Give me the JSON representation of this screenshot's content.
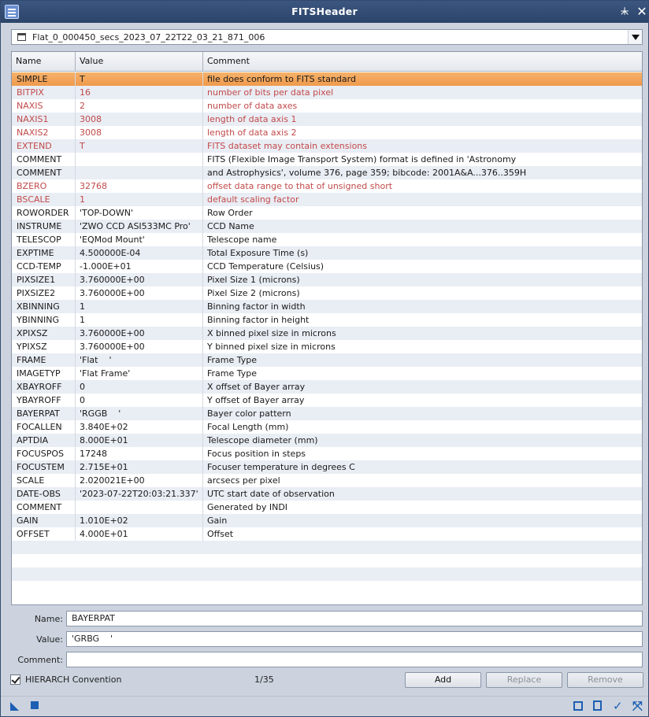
{
  "window": {
    "title": "FITSHeader",
    "app_icon": "fitsheader-app-icon",
    "collapse_icon": "⯸",
    "close_icon": "✕"
  },
  "file_select": {
    "value": "Flat_0_000450_secs_2023_07_22T22_03_21_871_006"
  },
  "table": {
    "headers": {
      "name": "Name",
      "value": "Value",
      "comment": "Comment"
    },
    "rows": [
      {
        "name": "SIMPLE",
        "value": "T",
        "comment": "file does conform to FITS standard",
        "reserved": true,
        "selected": true
      },
      {
        "name": "BITPIX",
        "value": "16",
        "comment": "number of bits per data pixel",
        "reserved": true
      },
      {
        "name": "NAXIS",
        "value": "2",
        "comment": "number of data axes",
        "reserved": true
      },
      {
        "name": "NAXIS1",
        "value": "3008",
        "comment": "length of data axis 1",
        "reserved": true
      },
      {
        "name": "NAXIS2",
        "value": "3008",
        "comment": "length of data axis 2",
        "reserved": true
      },
      {
        "name": "EXTEND",
        "value": "T",
        "comment": "FITS dataset may contain extensions",
        "reserved": true
      },
      {
        "name": "COMMENT",
        "value": "",
        "comment": "FITS (Flexible Image Transport System) format is defined in 'Astronomy"
      },
      {
        "name": "COMMENT",
        "value": "",
        "comment": "and Astrophysics', volume 376, page 359; bibcode: 2001A&A...376..359H"
      },
      {
        "name": "BZERO",
        "value": "32768",
        "comment": "offset data range to that of unsigned short",
        "reserved": true
      },
      {
        "name": "BSCALE",
        "value": "1",
        "comment": "default scaling factor",
        "reserved": true
      },
      {
        "name": "ROWORDER",
        "value": "'TOP-DOWN'",
        "comment": "Row Order"
      },
      {
        "name": "INSTRUME",
        "value": "'ZWO CCD ASI533MC Pro'",
        "comment": "CCD Name"
      },
      {
        "name": "TELESCOP",
        "value": "'EQMod Mount'",
        "comment": "Telescope name"
      },
      {
        "name": "EXPTIME",
        "value": "4.500000E-04",
        "comment": "Total Exposure Time (s)"
      },
      {
        "name": "CCD-TEMP",
        "value": "-1.000E+01",
        "comment": "CCD Temperature (Celsius)"
      },
      {
        "name": "PIXSIZE1",
        "value": "3.760000E+00",
        "comment": "Pixel Size 1 (microns)"
      },
      {
        "name": "PIXSIZE2",
        "value": "3.760000E+00",
        "comment": "Pixel Size 2 (microns)"
      },
      {
        "name": "XBINNING",
        "value": "1",
        "comment": "Binning factor in width"
      },
      {
        "name": "YBINNING",
        "value": "1",
        "comment": "Binning factor in height"
      },
      {
        "name": "XPIXSZ",
        "value": "3.760000E+00",
        "comment": "X binned pixel size in microns"
      },
      {
        "name": "YPIXSZ",
        "value": "3.760000E+00",
        "comment": "Y binned pixel size in microns"
      },
      {
        "name": "FRAME",
        "value": "'Flat    '",
        "comment": "Frame Type"
      },
      {
        "name": "IMAGETYP",
        "value": "'Flat Frame'",
        "comment": "Frame Type"
      },
      {
        "name": "XBAYROFF",
        "value": "0",
        "comment": "X offset of Bayer array"
      },
      {
        "name": "YBAYROFF",
        "value": "0",
        "comment": "Y offset of Bayer array"
      },
      {
        "name": "BAYERPAT",
        "value": "'RGGB    '",
        "comment": "Bayer color pattern"
      },
      {
        "name": "FOCALLEN",
        "value": "3.840E+02",
        "comment": "Focal Length (mm)"
      },
      {
        "name": "APTDIA",
        "value": "8.000E+01",
        "comment": "Telescope diameter (mm)"
      },
      {
        "name": "FOCUSPOS",
        "value": "17248",
        "comment": "Focus position in steps"
      },
      {
        "name": "FOCUSTEM",
        "value": "2.715E+01",
        "comment": "Focuser temperature in degrees C"
      },
      {
        "name": "SCALE",
        "value": "2.020021E+00",
        "comment": "arcsecs per pixel"
      },
      {
        "name": "DATE-OBS",
        "value": "'2023-07-22T20:03:21.337'",
        "comment": "UTC start date of observation"
      },
      {
        "name": "COMMENT",
        "value": "",
        "comment": "Generated by INDI"
      },
      {
        "name": "GAIN",
        "value": "1.010E+02",
        "comment": "Gain"
      },
      {
        "name": "OFFSET",
        "value": "4.000E+01",
        "comment": "Offset"
      }
    ]
  },
  "form": {
    "name_label": "Name:",
    "name_value": "BAYERPAT",
    "value_label": "Value:",
    "value_value": "'GRBG    '",
    "comment_label": "Comment:",
    "comment_value": ""
  },
  "options": {
    "hierarch_label": "HIERARCH Convention",
    "hierarch_checked": true,
    "counter": "1/35"
  },
  "buttons": {
    "add": "Add",
    "replace": "Replace",
    "remove": "Remove"
  },
  "colors": {
    "reserved_keyword": "#c24a4a",
    "selection": "#f0a055",
    "titlebar": "#31496f",
    "tool_icon": "#1d5fb3"
  }
}
